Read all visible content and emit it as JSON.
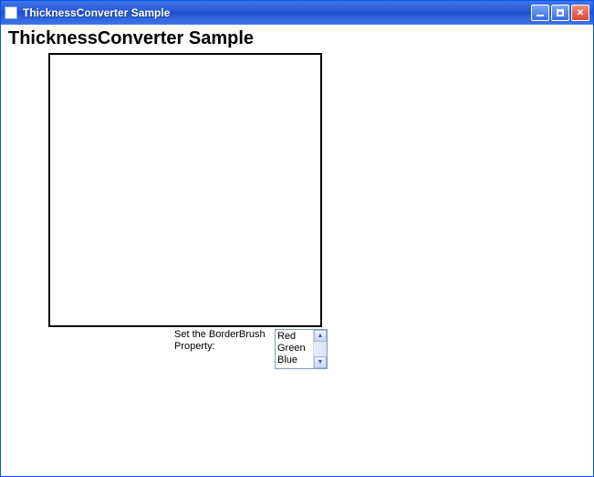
{
  "window": {
    "title": "ThicknessConverter Sample"
  },
  "content": {
    "heading": "ThicknessConverter Sample",
    "border_brush_label": "Set the BorderBrush Property:",
    "color_options": {
      "item0": "Red",
      "item1": "Green",
      "item2": "Blue"
    }
  }
}
